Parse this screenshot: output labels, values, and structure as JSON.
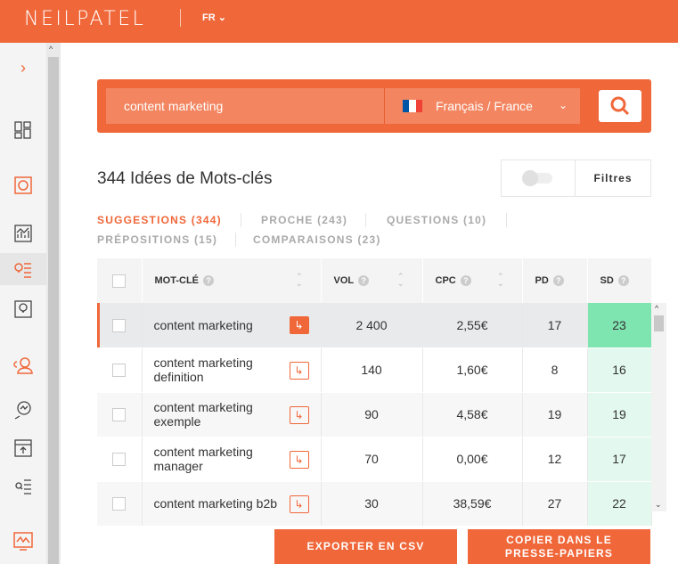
{
  "header": {
    "logo": "NEILPATEL",
    "language": "FR"
  },
  "search": {
    "query": "content marketing",
    "locale": "Français / France",
    "flag_colors": [
      "#0055a4",
      "#ffffff",
      "#ef4135"
    ]
  },
  "results": {
    "title": "344 Idées de Mots-clés",
    "filters_label": "Filtres"
  },
  "tabs": [
    {
      "label": "SUGGESTIONS (344)",
      "active": true
    },
    {
      "label": "PROCHE (243)"
    },
    {
      "label": "QUESTIONS (10)"
    },
    {
      "label": "PRÉPOSITIONS (15)"
    },
    {
      "label": "COMPARAISONS (23)"
    }
  ],
  "table": {
    "columns": [
      "MOT-CLÉ",
      "VOL",
      "CPC",
      "PD",
      "SD"
    ],
    "rows": [
      {
        "keyword": "content marketing",
        "vol": "2 400",
        "cpc": "2,55€",
        "pd": "17",
        "sd": "23"
      },
      {
        "keyword": "content marketing definition",
        "vol": "140",
        "cpc": "1,60€",
        "pd": "8",
        "sd": "16"
      },
      {
        "keyword": "content marketing exemple",
        "vol": "90",
        "cpc": "4,58€",
        "pd": "19",
        "sd": "19"
      },
      {
        "keyword": "content marketing manager",
        "vol": "70",
        "cpc": "0,00€",
        "pd": "12",
        "sd": "17"
      },
      {
        "keyword": "content marketing b2b",
        "vol": "30",
        "cpc": "38,59€",
        "pd": "27",
        "sd": "22"
      }
    ]
  },
  "actions": {
    "export": "EXPORTER EN CSV",
    "copy": "COPIER DANS LE PRESSE-PAPIERS"
  },
  "colors": {
    "brand": "#f0673a",
    "sd_high": "#7ee4b0",
    "sd_low": "#e3f8ee"
  }
}
